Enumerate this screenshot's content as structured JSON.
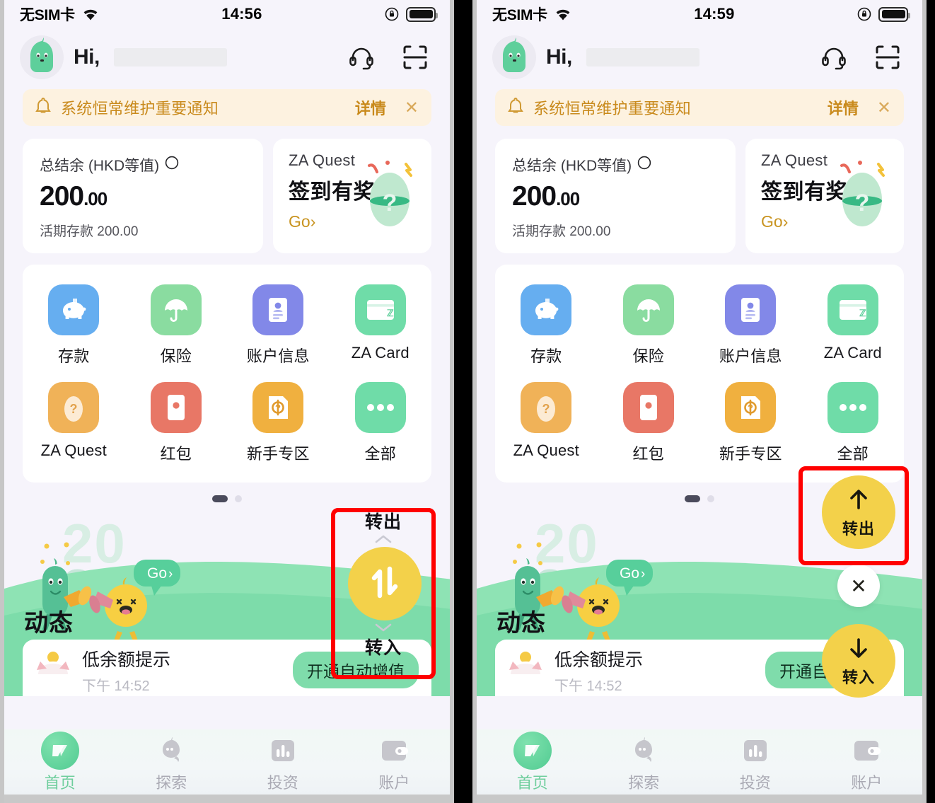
{
  "app": {
    "name": "ZA Bank Mobile App",
    "accent_yellow": "#F3D14A",
    "accent_green": "#6FCE9D",
    "accent_orange": "#C98A1C",
    "annotation_color": "#FF0000"
  },
  "left": {
    "status": {
      "carrier": "无SIM卡",
      "time": "14:56",
      "wifi_icon": "wifi-icon",
      "rotation_lock_icon": "rotation-lock-icon",
      "battery_icon": "battery-full-icon"
    },
    "header": {
      "greeting": "Hi,",
      "name_masked": "",
      "avatar_icon": "mascot-avatar-icon",
      "support_icon": "headset-icon",
      "scan_icon": "scan-qr-icon"
    },
    "notice": {
      "bell_icon": "bell-icon",
      "text": "系统恒常维护重要通知",
      "action": "详情",
      "close_icon": "close-icon"
    },
    "balance_card": {
      "label": "总结余 (HKD等值)",
      "eye_icon": "visibility-toggle-icon",
      "amount_int": "200",
      "amount_dec": ".00",
      "sub": "活期存款 200.00"
    },
    "quest_card": {
      "title": "ZA Quest",
      "headline": "签到有奖",
      "cta": "Go",
      "chevron": "›",
      "egg_icon": "mystery-egg-icon"
    },
    "grid": {
      "row1": [
        {
          "label": "存款",
          "icon": "piggy-bank-icon",
          "color": "#66AEF0"
        },
        {
          "label": "保险",
          "icon": "umbrella-icon",
          "color": "#8ADCA0"
        },
        {
          "label": "账户信息",
          "icon": "id-card-icon",
          "color": "#8288E8"
        },
        {
          "label": "ZA Card",
          "icon": "credit-card-icon",
          "color": "#6FDCA8"
        }
      ],
      "row2": [
        {
          "label": "ZA Quest",
          "icon": "quest-egg-icon",
          "color": "#F0B258"
        },
        {
          "label": "红包",
          "icon": "red-packet-icon",
          "color": "#E87766"
        },
        {
          "label": "新手专区",
          "icon": "newbie-zone-icon",
          "color": "#F0B03F"
        },
        {
          "label": "全部",
          "icon": "more-dots-icon",
          "color": "#6FDCA8"
        }
      ]
    },
    "pager": {
      "active_index": 0,
      "count": 2
    },
    "hero": {
      "year_top": "20",
      "year_bottom": "24",
      "go_label": "Go",
      "go_chevron": "›",
      "mascot_green_icon": "mascot-green-megaphone-icon",
      "mascot_yellow_icon": "mascot-yellow-megaphone-icon"
    },
    "section_title": "动态",
    "low_card": {
      "title": "低余额提示",
      "time": "下午 14:52",
      "button": "开通自动增值",
      "icon": "piggy-coin-icon"
    },
    "transfer": {
      "out_label": "转出",
      "in_label": "转入",
      "toggle_icon": "transfer-updown-icon",
      "chevron_up": "⌃",
      "chevron_down": "⌄"
    },
    "nav": [
      {
        "label": "首页",
        "icon": "home-za-icon",
        "active": true
      },
      {
        "label": "探索",
        "icon": "explore-mascot-icon",
        "active": false
      },
      {
        "label": "投资",
        "icon": "invest-chart-icon",
        "active": false
      },
      {
        "label": "账户",
        "icon": "wallet-icon",
        "active": false
      }
    ]
  },
  "right": {
    "status": {
      "carrier": "无SIM卡",
      "time": "14:59",
      "wifi_icon": "wifi-icon",
      "rotation_lock_icon": "rotation-lock-icon",
      "battery_icon": "battery-full-icon"
    },
    "header": {
      "greeting": "Hi,",
      "name_masked": "",
      "avatar_icon": "mascot-avatar-icon",
      "support_icon": "headset-icon",
      "scan_icon": "scan-qr-icon"
    },
    "notice": {
      "bell_icon": "bell-icon",
      "text": "系统恒常维护重要通知",
      "action": "详情",
      "close_icon": "close-icon"
    },
    "balance_card": {
      "label": "总结余 (HKD等值)",
      "eye_icon": "visibility-toggle-icon",
      "amount_int": "200",
      "amount_dec": ".00",
      "sub": "活期存款 200.00"
    },
    "quest_card": {
      "title": "ZA Quest",
      "headline": "签到有奖",
      "cta": "Go",
      "chevron": "›",
      "egg_icon": "mystery-egg-icon"
    },
    "grid": {
      "row1": [
        {
          "label": "存款",
          "icon": "piggy-bank-icon",
          "color": "#66AEF0"
        },
        {
          "label": "保险",
          "icon": "umbrella-icon",
          "color": "#8ADCA0"
        },
        {
          "label": "账户信息",
          "icon": "id-card-icon",
          "color": "#8288E8"
        },
        {
          "label": "ZA Card",
          "icon": "credit-card-icon",
          "color": "#6FDCA8"
        }
      ],
      "row2": [
        {
          "label": "ZA Quest",
          "icon": "quest-egg-icon",
          "color": "#F0B258"
        },
        {
          "label": "红包",
          "icon": "red-packet-icon",
          "color": "#E87766"
        },
        {
          "label": "新手专区",
          "icon": "newbie-zone-icon",
          "color": "#F0B03F"
        },
        {
          "label": "全部",
          "icon": "more-dots-icon",
          "color": "#6FDCA8"
        }
      ]
    },
    "pager": {
      "active_index": 0,
      "count": 2
    },
    "hero": {
      "year_top": "20",
      "year_bottom": "24",
      "go_label": "Go",
      "go_chevron": "›",
      "mascot_green_icon": "mascot-green-megaphone-icon",
      "mascot_yellow_icon": "mascot-yellow-megaphone-icon"
    },
    "section_title": "动态",
    "low_card": {
      "title": "低余额提示",
      "time": "下午 14:52",
      "button": "开通自动增值",
      "icon": "piggy-coin-icon"
    },
    "transfer_expanded": {
      "out_label": "转出",
      "out_icon": "arrow-up-icon",
      "in_label": "转入",
      "in_icon": "arrow-down-icon",
      "close_icon": "close-icon"
    },
    "nav": [
      {
        "label": "首页",
        "icon": "home-za-icon",
        "active": true
      },
      {
        "label": "探索",
        "icon": "explore-mascot-icon",
        "active": false
      },
      {
        "label": "投资",
        "icon": "invest-chart-icon",
        "active": false
      },
      {
        "label": "账户",
        "icon": "wallet-icon",
        "active": false
      }
    ]
  }
}
